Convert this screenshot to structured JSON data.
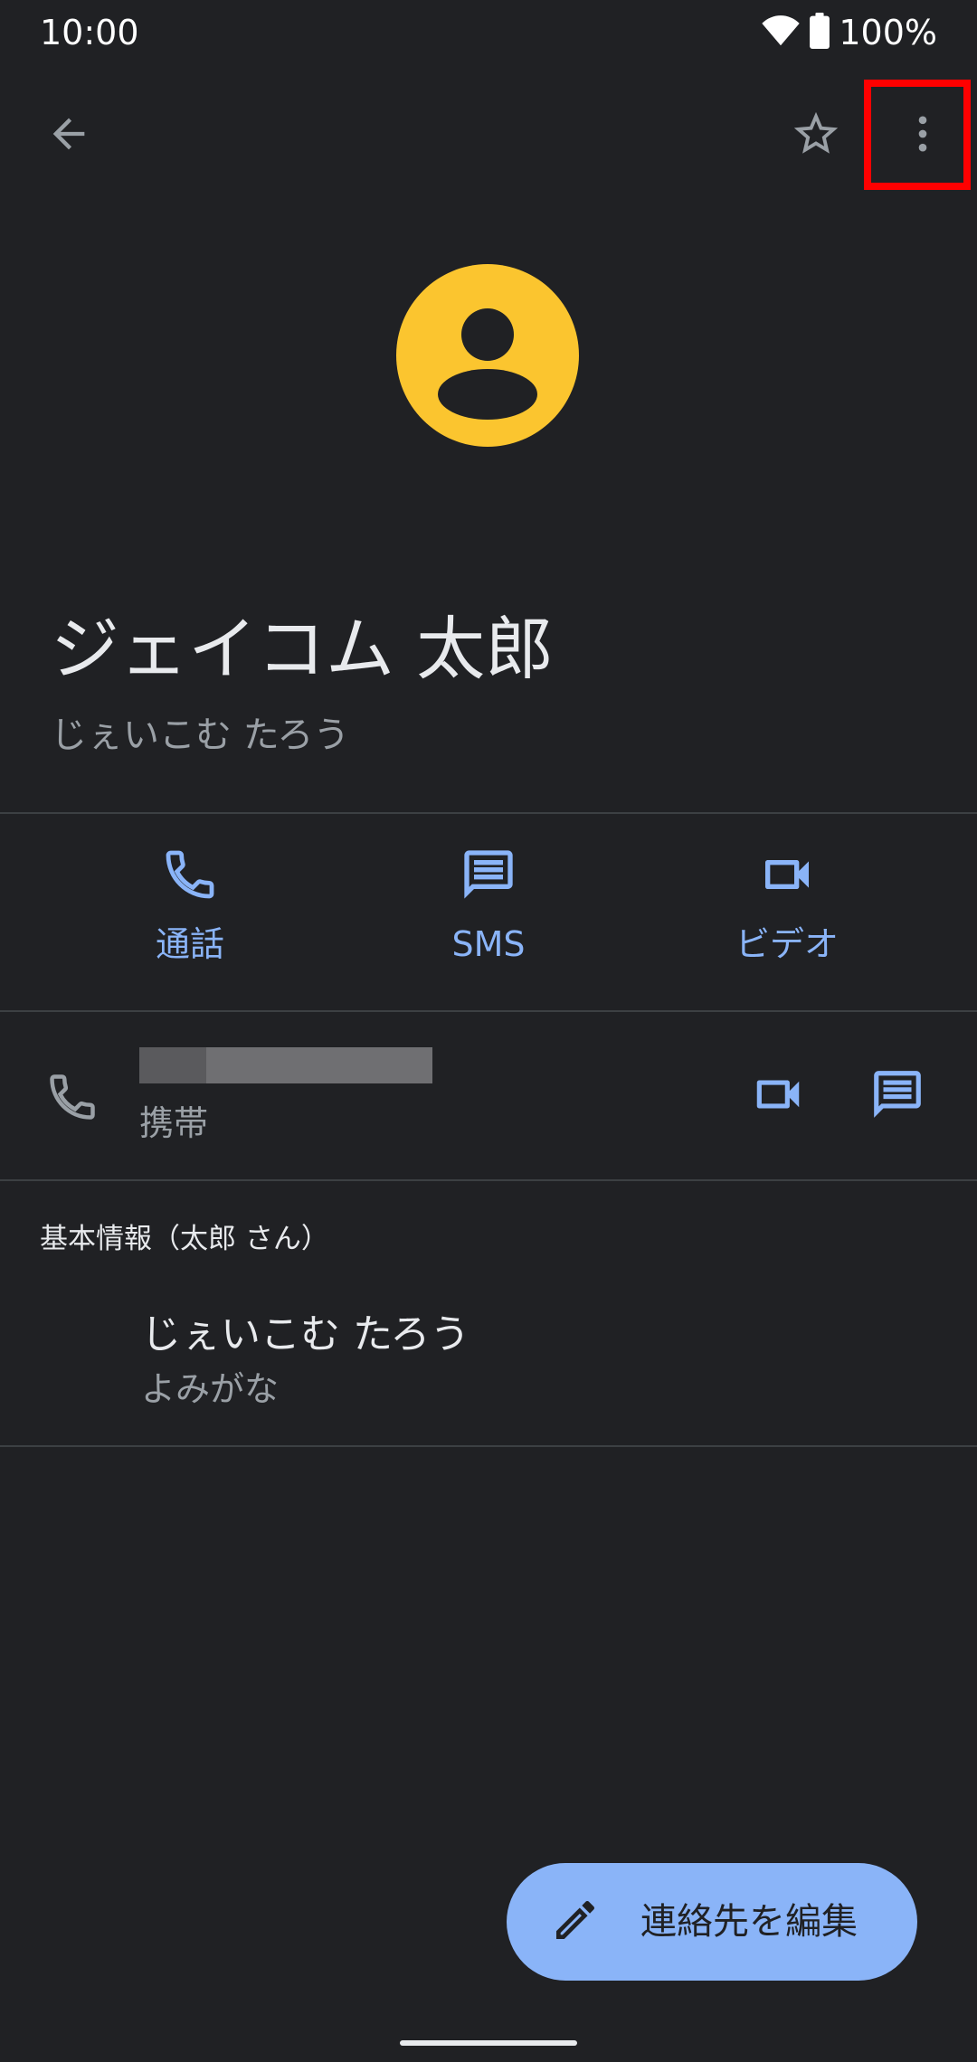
{
  "status_bar": {
    "time": "10:00",
    "battery_percent": "100%",
    "icons": [
      "wifi-icon",
      "battery-icon"
    ]
  },
  "app_bar": {
    "icons": [
      "back-arrow-icon",
      "star-outline-icon",
      "more-vert-icon"
    ]
  },
  "contact": {
    "name": "ジェイコム 太郎",
    "phonetic": "じぇいこむ たろう",
    "avatar_icon": "person-icon",
    "avatar_color": "#fbc52f"
  },
  "actions": [
    {
      "label": "通話",
      "icon": "phone-icon"
    },
    {
      "label": "SMS",
      "icon": "message-icon"
    },
    {
      "label": "ビデオ",
      "icon": "videocam-icon"
    }
  ],
  "phone_entry": {
    "type_label": "携帯",
    "icons": [
      "phone-icon",
      "videocam-icon",
      "message-icon"
    ]
  },
  "about": {
    "title": "基本情報（太郎 さん）",
    "value": "じぇいこむ たろう",
    "label": "よみがな"
  },
  "fab": {
    "label": "連絡先を編集",
    "icon": "edit-pencil-icon"
  },
  "colors": {
    "background": "#202124",
    "accent": "#8ab4f8",
    "highlight": "#ff0000"
  }
}
